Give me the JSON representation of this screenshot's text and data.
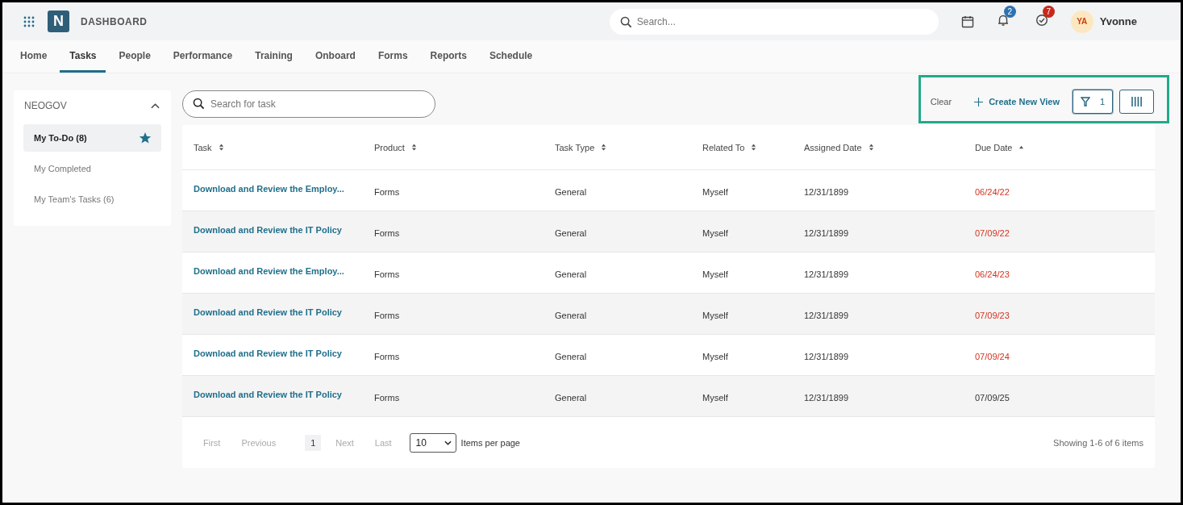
{
  "header": {
    "title": "DASHBOARD",
    "logo_letter": "N",
    "search": {
      "placeholder": "Search..."
    },
    "notifications": "2",
    "tasks_badge": "7",
    "user": {
      "initials": "YA",
      "name": "Yvonne"
    }
  },
  "nav": [
    {
      "label": "Home",
      "selected": false
    },
    {
      "label": "Tasks",
      "selected": true
    },
    {
      "label": "People",
      "selected": false
    },
    {
      "label": "Performance",
      "selected": false
    },
    {
      "label": "Training",
      "selected": false
    },
    {
      "label": "Onboard",
      "selected": false
    },
    {
      "label": "Forms",
      "selected": false
    },
    {
      "label": "Reports",
      "selected": false
    },
    {
      "label": "Schedule",
      "selected": false
    }
  ],
  "sidebar": {
    "title": "NEOGOV",
    "expanded": true,
    "items": [
      {
        "label": "My To-Do (8)",
        "selected": true,
        "starred": true
      },
      {
        "label": "My Completed",
        "selected": false,
        "starred": false
      },
      {
        "label": "My Team's Tasks (6)",
        "selected": false,
        "starred": false
      }
    ]
  },
  "task_search": {
    "placeholder": "Search for task"
  },
  "toolbar": {
    "clear": "Clear",
    "create_view": "Create New View",
    "filter_count": "1",
    "highlighted": true
  },
  "table": {
    "columns": [
      {
        "label": "Task",
        "sorted": false
      },
      {
        "label": "Product",
        "sorted": false
      },
      {
        "label": "Task Type",
        "sorted": false
      },
      {
        "label": "Related To",
        "sorted": false
      },
      {
        "label": "Assigned Date",
        "sorted": false
      },
      {
        "label": "Due Date",
        "sorted": true
      }
    ],
    "rows": [
      {
        "task": "Download and Review the Employ...",
        "product": "Forms",
        "type": "General",
        "related": "Myself",
        "assigned": "12/31/1899",
        "due": "06/24/22",
        "overdue": true
      },
      {
        "task": "Download and Review the IT Policy",
        "product": "Forms",
        "type": "General",
        "related": "Myself",
        "assigned": "12/31/1899",
        "due": "07/09/22",
        "overdue": true
      },
      {
        "task": "Download and Review the Employ...",
        "product": "Forms",
        "type": "General",
        "related": "Myself",
        "assigned": "12/31/1899",
        "due": "06/24/23",
        "overdue": true
      },
      {
        "task": "Download and Review the IT Policy",
        "product": "Forms",
        "type": "General",
        "related": "Myself",
        "assigned": "12/31/1899",
        "due": "07/09/23",
        "overdue": true
      },
      {
        "task": "Download and Review the IT Policy",
        "product": "Forms",
        "type": "General",
        "related": "Myself",
        "assigned": "12/31/1899",
        "due": "07/09/24",
        "overdue": true
      },
      {
        "task": "Download and Review the IT Policy",
        "product": "Forms",
        "type": "General",
        "related": "Myself",
        "assigned": "12/31/1899",
        "due": "07/09/25",
        "overdue": false
      }
    ]
  },
  "pagination": {
    "first": "First",
    "previous": "Previous",
    "page": "1",
    "next": "Next",
    "last": "Last",
    "per_page": "10",
    "per_page_label": "Items per page",
    "summary": "Showing 1-6 of 6 items"
  }
}
